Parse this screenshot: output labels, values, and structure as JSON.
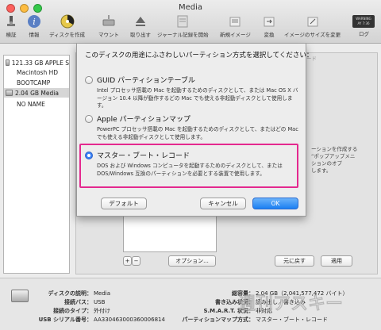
{
  "window": {
    "title": "Media"
  },
  "toolbar": {
    "items": [
      {
        "label": "検証",
        "icon": "microscope-icon"
      },
      {
        "label": "情報",
        "icon": "info-icon"
      },
      {
        "label": "ディスクを作成",
        "icon": "burn-icon"
      },
      {
        "label": "マウント",
        "icon": "mount-icon"
      },
      {
        "label": "取り出す",
        "icon": "eject-icon"
      },
      {
        "label": "ジャーナル記録を開始",
        "icon": "journal-icon"
      },
      {
        "label": "新規イメージ",
        "icon": "new-image-icon"
      },
      {
        "label": "変換",
        "icon": "convert-icon"
      },
      {
        "label": "イメージのサイズを変更",
        "icon": "resize-icon"
      },
      {
        "label": "ログ",
        "icon": "log-icon"
      }
    ],
    "log_badge": "WARNING\nAY 7:36"
  },
  "sidebar": {
    "items": [
      {
        "label": "121.33 GB APPLE S",
        "indent": 0
      },
      {
        "label": "Macintosh HD",
        "indent": 1
      },
      {
        "label": "BOOTCAMP",
        "indent": 1
      },
      {
        "label": "2.04 GB Media",
        "indent": 0
      },
      {
        "label": "NO NAME",
        "indent": 1
      }
    ]
  },
  "sheet": {
    "prompt": "このディスクの用途にふさわしいパーティション方式を選択してください：",
    "options": [
      {
        "title": "GUID パーティションテーブル",
        "selected": false,
        "desc": "Intel プロセッサ搭載の Mac を起動するためのディスクとして、または Mac OS X バージョン 10.4 以降が動作するどの Mac でも使える非起動ディスクとして使用します。"
      },
      {
        "title": "Apple パーティションマップ",
        "selected": false,
        "desc": "PowerPC プロセッサ搭載の Mac を起動するためのディスクとして、またはどの Mac でも使える非起動ディスクとして使用します。"
      },
      {
        "title": "マスター・ブート・レコード",
        "selected": true,
        "desc": "DOS および Windows コンピュータを起動するためのディスクとして、または DOS/Windows 互換のパーティションを必要とする装置で使用します。"
      }
    ],
    "buttons": {
      "default": "デフォルト",
      "cancel": "キャンセル",
      "ok": "OK"
    }
  },
  "main": {
    "options_button": "オプション...",
    "revert_button": "元に戻す",
    "apply_button": "適用",
    "plus": "+",
    "minus": "−",
    "ghost_right": "ーションを作成する\n“ポップアップメニ\nションのオプ\nします。",
    "ghost_top": "ード"
  },
  "info": {
    "left": [
      {
        "k": "ディスクの説明：",
        "v": "Media"
      },
      {
        "k": "接続バス：",
        "v": "USB"
      },
      {
        "k": "接続のタイプ：",
        "v": "外付け"
      },
      {
        "k": "USB シリアル番号：",
        "v": "AA330463000360006814"
      }
    ],
    "right": [
      {
        "k": "総容量：",
        "v": "2.04 GB（2,041,577,472 バイト）"
      },
      {
        "k": "書き込み状況：",
        "v": "読み出し／書き込み"
      },
      {
        "k": "S.M.A.R.T. 状況：",
        "v": "非対応"
      },
      {
        "k": "パーティションマップ方式：",
        "v": "マスター・ブート・レコード"
      }
    ]
  },
  "watermark": "週刊アスキー"
}
